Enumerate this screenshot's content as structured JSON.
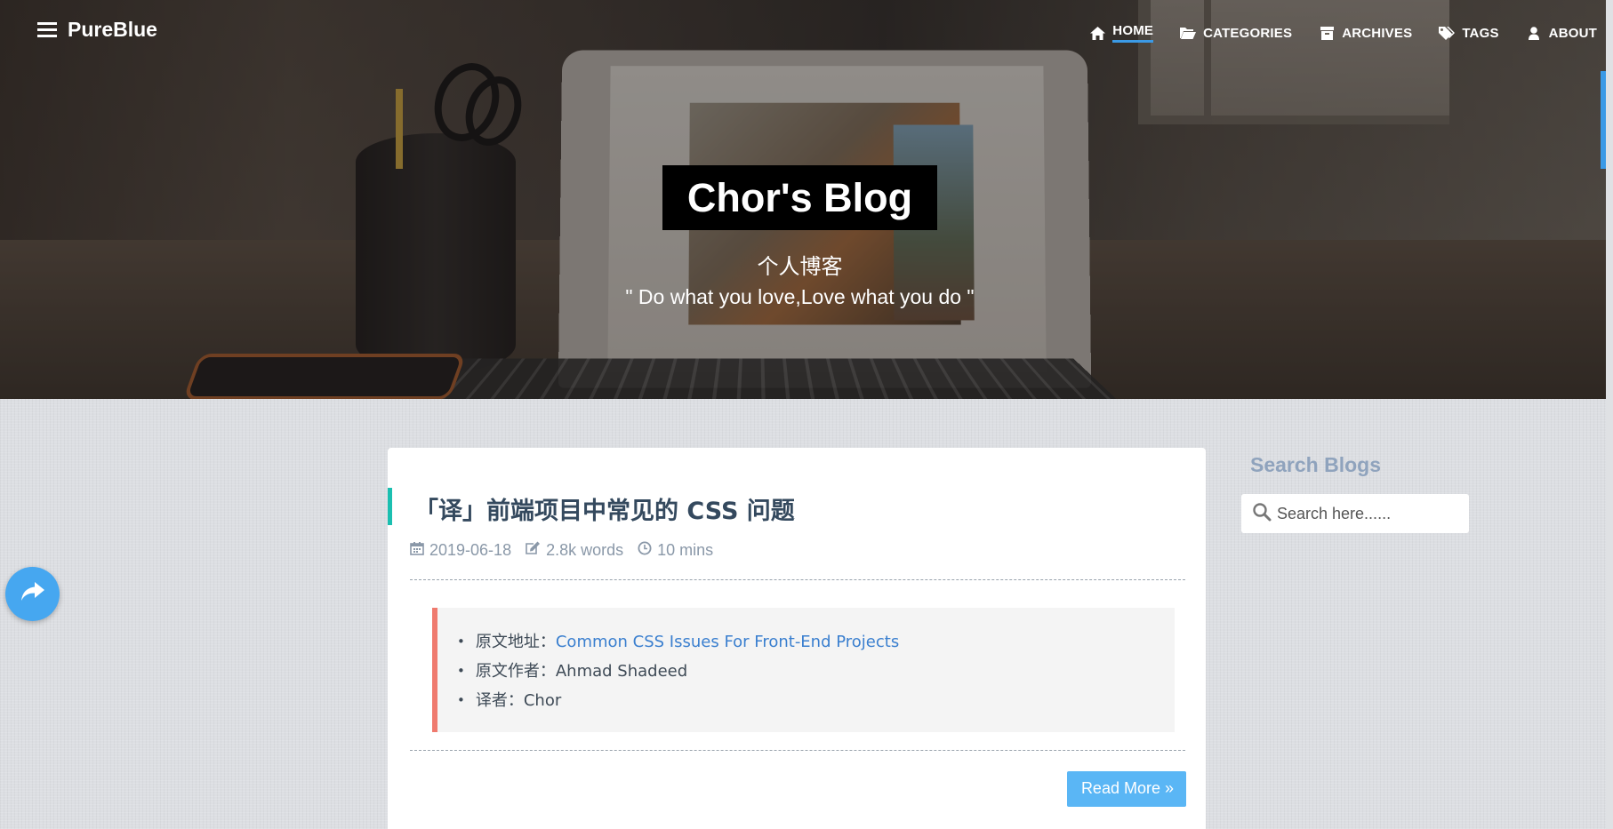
{
  "brand": {
    "name": "PureBlue"
  },
  "nav": {
    "items": [
      {
        "label": "HOME",
        "icon": "home-icon",
        "active": true
      },
      {
        "label": "CATEGORIES",
        "icon": "folder-open-icon"
      },
      {
        "label": "ARCHIVES",
        "icon": "archive-icon"
      },
      {
        "label": "TAGS",
        "icon": "tags-icon"
      },
      {
        "label": "ABOUT",
        "icon": "user-icon"
      }
    ]
  },
  "hero": {
    "title": "Chor's Blog",
    "subtitle": "个人博客",
    "motto": "\" Do what you love,Love what you do \""
  },
  "post": {
    "title": "「译」前端项目中常见的 CSS 问题",
    "date": "2019-06-18",
    "words": "2.8k words",
    "read_time": "10 mins",
    "quote": [
      {
        "label": "原文地址：",
        "value": "Common CSS Issues For Front-End Projects",
        "is_link": true
      },
      {
        "label": "原文作者：",
        "value": "Ahmad Shadeed"
      },
      {
        "label": "译者：",
        "value": "Chor"
      }
    ],
    "read_more": "Read More »"
  },
  "sidebar": {
    "search_title": "Search Blogs",
    "search_placeholder": "Search here......"
  },
  "colors": {
    "accent": "#3b9ae6",
    "title_bar": "#1bbfb0",
    "quote_border": "#ef7a6e",
    "read_more": "#5ab6f5",
    "share_fab": "#46a7f0"
  }
}
